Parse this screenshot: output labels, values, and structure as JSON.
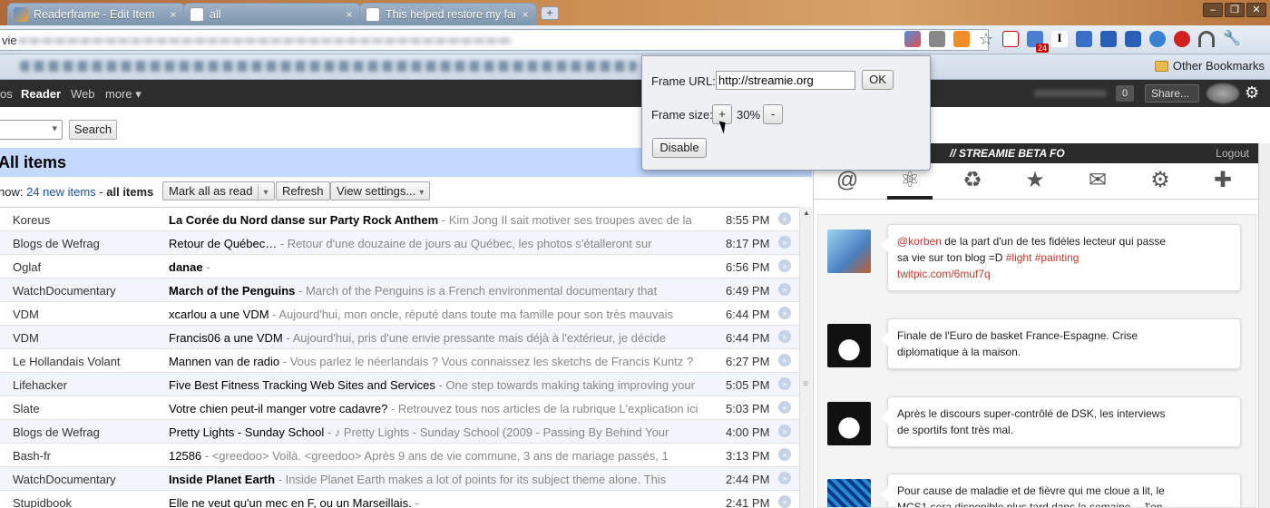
{
  "tabs": [
    {
      "title": "Readerframe - Edit Item",
      "close": "×"
    },
    {
      "title": "all",
      "close": "×"
    },
    {
      "title": "This helped restore my fai",
      "close": "×"
    }
  ],
  "new_tab": "+",
  "window_buttons": [
    "‒",
    "❐",
    "✕"
  ],
  "omnibox": {
    "text": "vie"
  },
  "bookmarks": {
    "other": "Other Bookmarks"
  },
  "gbar": {
    "nav_prefix": "os",
    "reader": "Reader",
    "web": "Web",
    "more": "more ▾",
    "count": "0",
    "share": "Share..."
  },
  "search": {
    "button": "Search"
  },
  "reader": {
    "title": "All items",
    "show_label": "how:",
    "new_items": "24 new items",
    "dash": " - ",
    "all_items": "all items",
    "mark_all": "Mark all as read",
    "refresh": "Refresh",
    "view_settings": "View settings...",
    "items": [
      {
        "source": "Koreus",
        "title": "La Corée du Nord danse sur Party Rock Anthem",
        "snippet": " - Kim Jong Il sait motiver ses troupes avec de la",
        "time": "8:55 PM",
        "unread": true
      },
      {
        "source": "Blogs de Wefrag",
        "title": "Retour de Québec…",
        "snippet": " - Retour d'une douzaine de jours au Québec, les photos s'étalleront sur",
        "time": "8:17 PM",
        "unread": false
      },
      {
        "source": "Oglaf",
        "title": "danae",
        "snippet": " -",
        "time": "6:56 PM",
        "unread": true
      },
      {
        "source": "WatchDocumentary",
        "title": "March of the Penguins",
        "snippet": " - March of the Penguins is a French environmental documentary that",
        "time": "6:49 PM",
        "unread": true
      },
      {
        "source": "VDM",
        "title": "xcarlou a une VDM",
        "snippet": " - Aujourd'hui, mon oncle, réputé dans toute ma famille pour son très mauvais",
        "time": "6:44 PM",
        "unread": false
      },
      {
        "source": "VDM",
        "title": "Francis06 a une VDM",
        "snippet": " - Aujourd'hui, pris d'une envie pressante mais déjà à l'extérieur, je décide",
        "time": "6:44 PM",
        "unread": false
      },
      {
        "source": "Le Hollandais Volant",
        "title": "Mannen van de radio",
        "snippet": " - Vous parlez le néerlandais ? Vous connaissez les sketchs de Francis Kuntz ?",
        "time": "6:27 PM",
        "unread": false
      },
      {
        "source": "Lifehacker",
        "title": "Five Best Fitness Tracking Web Sites and Services",
        "snippet": " - One step towards making taking improving your",
        "time": "5:05 PM",
        "unread": false
      },
      {
        "source": "Slate",
        "title": "Votre chien peut-il manger votre cadavre?",
        "snippet": " - Retrouvez tous nos articles de la rubrique L'explication ici",
        "time": "5:03 PM",
        "unread": false
      },
      {
        "source": "Blogs de Wefrag",
        "title": "Pretty Lights - Sunday School",
        "snippet": " - ♪ Pretty Lights - Sunday School (2009 - Passing By Behind Your",
        "time": "4:00 PM",
        "unread": false
      },
      {
        "source": "Bash-fr",
        "title": "12586",
        "snippet": " - <greedoo> Voilà. <greedoo> Après 9 ans de vie commune, 3 ans de mariage passés, 1",
        "time": "3:13 PM",
        "unread": false
      },
      {
        "source": "WatchDocumentary",
        "title": "Inside Planet Earth",
        "snippet": " - Inside Planet Earth makes a lot of points for its subject theme alone. This",
        "time": "2:44 PM",
        "unread": true
      },
      {
        "source": "Stupidbook",
        "title": "Elle ne veut qu'un mec en F, ou un Marseillais.",
        "snippet": " -",
        "time": "2:41 PM",
        "unread": false
      }
    ]
  },
  "streamie": {
    "header": "// STREAMIE BETA FO",
    "logout": "Logout",
    "icons": [
      "@",
      "⚛",
      "♻",
      "★",
      "✉",
      "⚙",
      "✚"
    ],
    "tweets": [
      {
        "mention": "@korben",
        "text1": " de la part d'un de tes fidèles lecteur qui passe",
        "text2": "sa vie sur ton blog =D ",
        "tag1": "#light",
        "tag2": " #painting",
        "link": "twitpic.com/6muf7q"
      },
      {
        "text": "Finale de l'Euro de basket France-Espagne. Crise",
        "text2": "diplomatique à la maison."
      },
      {
        "text": "Après le discours super-contrôlé de DSK, les interviews",
        "text2": "de sportifs font très mal."
      },
      {
        "text": "Pour cause de maladie et de fièvre qui me cloue a lit, le",
        "text2": "MCS1 sera disponible plus tard dans la semaine... J'en"
      }
    ]
  },
  "popup": {
    "url_label": "Frame URL:",
    "url_value": "http://streamie.org",
    "ok": "OK",
    "size_label": "Frame size:",
    "plus": "+",
    "percent": "30%",
    "minus": "-",
    "disable": "Disable"
  },
  "colors": {
    "reader_title_bg": "#c3d9ff",
    "gbar_bg": "#2d2d2d",
    "link": "#1a4fa1",
    "tweet_link": "#c0392b"
  }
}
